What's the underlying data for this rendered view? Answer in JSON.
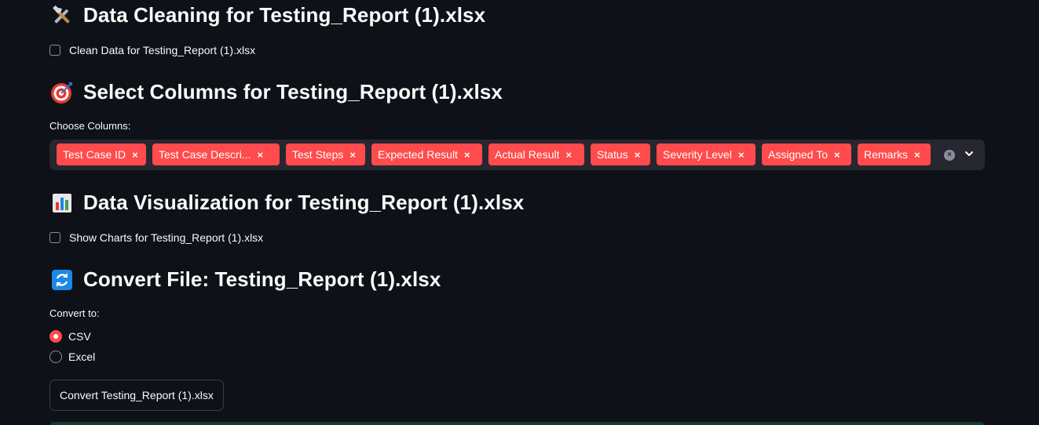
{
  "cleaning": {
    "title": "Data Cleaning for Testing_Report (1).xlsx",
    "icon": "tools-icon",
    "checkbox_label": "Clean Data for Testing_Report (1).xlsx"
  },
  "select_columns": {
    "title": "Select Columns for Testing_Report (1).xlsx",
    "icon": "direct-hit-icon",
    "label": "Choose Columns:",
    "tags": [
      "Test Case ID",
      "Test Case Descri...",
      "Test Steps",
      "Expected Result",
      "Actual Result",
      "Status",
      "Severity Level",
      "Assigned To",
      "Remarks"
    ],
    "remove_symbol": "×",
    "clear_symbol": "×"
  },
  "visualization": {
    "title": "Data Visualization for Testing_Report (1).xlsx",
    "icon": "bar-chart-icon",
    "checkbox_label": "Show Charts for Testing_Report (1).xlsx"
  },
  "convert": {
    "title": "Convert File: Testing_Report (1).xlsx",
    "icon": "refresh-arrows-icon",
    "label": "Convert to:",
    "options": [
      "CSV",
      "Excel"
    ],
    "selected": "CSV",
    "button_label": "Convert Testing_Report (1).xlsx"
  },
  "colors": {
    "background": "#0e1117",
    "accent": "#ff4b4b",
    "input_bg": "#262730",
    "text": "#fafafa"
  }
}
